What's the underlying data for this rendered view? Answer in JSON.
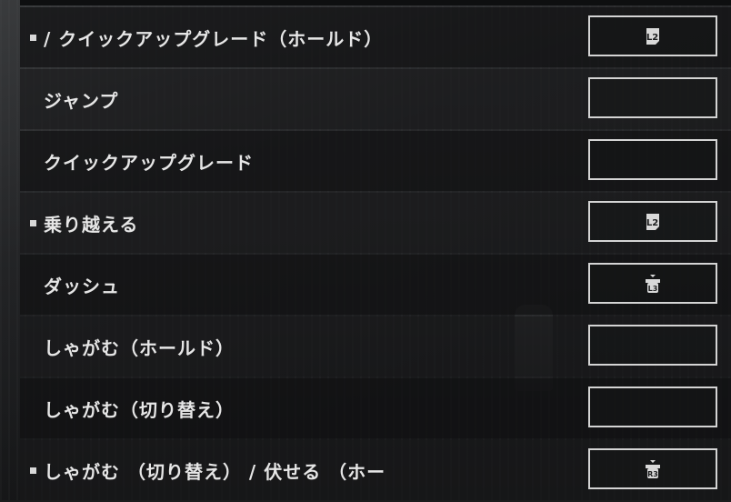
{
  "bindings": [
    {
      "label": "/ クイックアップグレード（ホールド）",
      "bulleted": true,
      "button": "L2",
      "icon": "l2-button-icon"
    },
    {
      "label": "ジャンプ",
      "bulleted": false,
      "button": "",
      "icon": ""
    },
    {
      "label": "クイックアップグレード",
      "bulleted": false,
      "button": "",
      "icon": ""
    },
    {
      "label": "乗り越える",
      "bulleted": true,
      "button": "L2",
      "icon": "l2-button-icon"
    },
    {
      "label": "ダッシュ",
      "bulleted": false,
      "button": "L3",
      "icon": "l3-stick-press-icon"
    },
    {
      "label": "しゃがむ（ホールド）",
      "bulleted": false,
      "button": "",
      "icon": ""
    },
    {
      "label": "しゃがむ（切り替え）",
      "bulleted": false,
      "button": "",
      "icon": ""
    },
    {
      "label": "しゃがむ （切り替え） / 伏せる （ホー",
      "bulleted": true,
      "button": "R3",
      "icon": "r3-stick-press-icon"
    }
  ],
  "colors": {
    "text": "#e6e6e6",
    "keybox_border": "#d4d4d4",
    "row_bg": "#101112"
  }
}
